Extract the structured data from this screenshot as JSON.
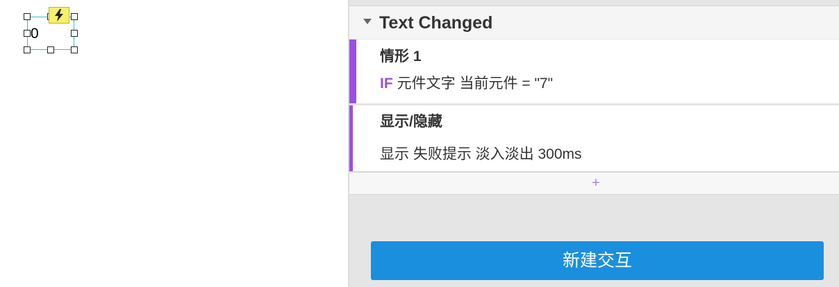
{
  "canvas": {
    "widget_text": "0",
    "event_badge_icon": "lightning-bolt-icon"
  },
  "panel": {
    "event": {
      "title": "Text Changed",
      "toggle_icon": "caret-down-icon"
    },
    "case": {
      "title": "情形 1",
      "if_keyword": "IF",
      "condition": "元件文字 当前元件 = \"7\""
    },
    "action": {
      "title": "显示/隐藏",
      "detail": "显示 失败提示 淡入淡出 300ms"
    },
    "add_action": {
      "icon": "plus-icon",
      "label": "+"
    },
    "new_interaction_button": "新建交互"
  },
  "colors": {
    "accent_purple": "#9c4fe6",
    "button_blue": "#1a8fdd",
    "selection_cyan": "#2cc3c7",
    "badge_yellow": "#f7f06a"
  }
}
